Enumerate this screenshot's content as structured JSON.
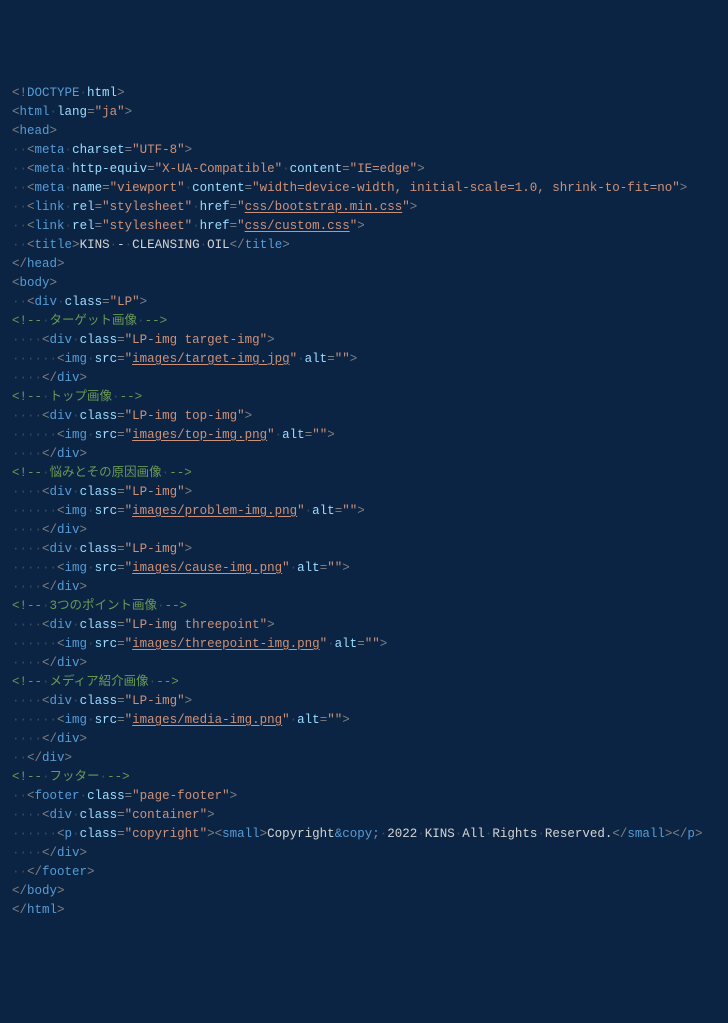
{
  "dot": "·",
  "lines": [
    [
      [
        "punc",
        "<!"
      ],
      [
        "tag",
        "DOCTYPE"
      ],
      [
        "ws",
        " "
      ],
      [
        "attr",
        "html"
      ],
      [
        "punc",
        ">"
      ]
    ],
    [
      [
        "punc",
        "<"
      ],
      [
        "tag",
        "html"
      ],
      [
        "ws",
        " "
      ],
      [
        "attr",
        "lang"
      ],
      [
        "punc",
        "="
      ],
      [
        "str",
        "\"ja\""
      ],
      [
        "punc",
        ">"
      ]
    ],
    [
      [
        "punc",
        "<"
      ],
      [
        "tag",
        "head"
      ],
      [
        "punc",
        ">"
      ]
    ],
    [
      [
        "ws",
        "  "
      ],
      [
        "punc",
        "<"
      ],
      [
        "tag",
        "meta"
      ],
      [
        "ws",
        " "
      ],
      [
        "attr",
        "charset"
      ],
      [
        "punc",
        "="
      ],
      [
        "str",
        "\"UTF-8\""
      ],
      [
        "punc",
        ">"
      ]
    ],
    [
      [
        "ws",
        "  "
      ],
      [
        "punc",
        "<"
      ],
      [
        "tag",
        "meta"
      ],
      [
        "ws",
        " "
      ],
      [
        "attr",
        "http-equiv"
      ],
      [
        "punc",
        "="
      ],
      [
        "str",
        "\"X-UA-Compatible\""
      ],
      [
        "ws",
        " "
      ],
      [
        "attr",
        "content"
      ],
      [
        "punc",
        "="
      ],
      [
        "str",
        "\"IE=edge\""
      ],
      [
        "punc",
        ">"
      ]
    ],
    [
      [
        "ws",
        "  "
      ],
      [
        "punc",
        "<"
      ],
      [
        "tag",
        "meta"
      ],
      [
        "ws",
        " "
      ],
      [
        "attr",
        "name"
      ],
      [
        "punc",
        "="
      ],
      [
        "str",
        "\"viewport\""
      ],
      [
        "ws",
        " "
      ],
      [
        "attr",
        "content"
      ],
      [
        "punc",
        "="
      ],
      [
        "str",
        "\"width=device-width, initial-scale=1.0, shrink-to-fit=no\""
      ],
      [
        "punc",
        ">"
      ]
    ],
    [
      [
        "ws",
        "  "
      ],
      [
        "punc",
        "<"
      ],
      [
        "tag",
        "link"
      ],
      [
        "ws",
        " "
      ],
      [
        "attr",
        "rel"
      ],
      [
        "punc",
        "="
      ],
      [
        "str",
        "\"stylesheet\""
      ],
      [
        "ws",
        " "
      ],
      [
        "attr",
        "href"
      ],
      [
        "punc",
        "="
      ],
      [
        "str",
        "\""
      ],
      [
        "strlink",
        "css/bootstrap.min.css"
      ],
      [
        "str",
        "\""
      ],
      [
        "punc",
        ">"
      ]
    ],
    [
      [
        "ws",
        "  "
      ],
      [
        "punc",
        "<"
      ],
      [
        "tag",
        "link"
      ],
      [
        "ws",
        " "
      ],
      [
        "attr",
        "rel"
      ],
      [
        "punc",
        "="
      ],
      [
        "str",
        "\"stylesheet\""
      ],
      [
        "ws",
        " "
      ],
      [
        "attr",
        "href"
      ],
      [
        "punc",
        "="
      ],
      [
        "str",
        "\""
      ],
      [
        "strlink",
        "css/custom.css"
      ],
      [
        "str",
        "\""
      ],
      [
        "punc",
        ">"
      ]
    ],
    [
      [
        "ws",
        "  "
      ],
      [
        "punc",
        "<"
      ],
      [
        "tag",
        "title"
      ],
      [
        "punc",
        ">"
      ],
      [
        "txt",
        "KINS"
      ],
      [
        "ws",
        " "
      ],
      [
        "txt",
        "-"
      ],
      [
        "ws",
        " "
      ],
      [
        "txt",
        "CLEANSING"
      ],
      [
        "ws",
        " "
      ],
      [
        "txt",
        "OIL"
      ],
      [
        "punc",
        "</"
      ],
      [
        "tag",
        "title"
      ],
      [
        "punc",
        ">"
      ]
    ],
    [
      [
        "punc",
        "</"
      ],
      [
        "tag",
        "head"
      ],
      [
        "punc",
        ">"
      ]
    ],
    [
      [
        "punc",
        "<"
      ],
      [
        "tag",
        "body"
      ],
      [
        "punc",
        ">"
      ]
    ],
    [
      [
        "ws",
        "  "
      ],
      [
        "punc",
        "<"
      ],
      [
        "tag",
        "div"
      ],
      [
        "ws",
        " "
      ],
      [
        "attr",
        "class"
      ],
      [
        "punc",
        "="
      ],
      [
        "str",
        "\"LP\""
      ],
      [
        "punc",
        ">"
      ]
    ],
    [
      [
        "comment",
        "<!--"
      ],
      [
        "ws",
        " "
      ],
      [
        "comment",
        "ターゲット画像"
      ],
      [
        "ws",
        " "
      ],
      [
        "comment",
        "-->"
      ]
    ],
    [
      [
        "ws",
        "    "
      ],
      [
        "punc",
        "<"
      ],
      [
        "tag",
        "div"
      ],
      [
        "ws",
        " "
      ],
      [
        "attr",
        "class"
      ],
      [
        "punc",
        "="
      ],
      [
        "str",
        "\"LP-img target-img\""
      ],
      [
        "punc",
        ">"
      ]
    ],
    [
      [
        "ws",
        "      "
      ],
      [
        "punc",
        "<"
      ],
      [
        "tag",
        "img"
      ],
      [
        "ws",
        " "
      ],
      [
        "attr",
        "src"
      ],
      [
        "punc",
        "="
      ],
      [
        "str",
        "\""
      ],
      [
        "strlink",
        "images/target-img.jpg"
      ],
      [
        "str",
        "\""
      ],
      [
        "ws",
        " "
      ],
      [
        "attr",
        "alt"
      ],
      [
        "punc",
        "="
      ],
      [
        "str",
        "\"\""
      ],
      [
        "punc",
        ">"
      ]
    ],
    [
      [
        "ws",
        "    "
      ],
      [
        "punc",
        "</"
      ],
      [
        "tag",
        "div"
      ],
      [
        "punc",
        ">"
      ]
    ],
    [
      [
        "comment",
        "<!--"
      ],
      [
        "ws",
        " "
      ],
      [
        "comment",
        "トップ画像"
      ],
      [
        "ws",
        " "
      ],
      [
        "comment",
        "-->"
      ]
    ],
    [
      [
        "ws",
        "    "
      ],
      [
        "punc",
        "<"
      ],
      [
        "tag",
        "div"
      ],
      [
        "ws",
        " "
      ],
      [
        "attr",
        "class"
      ],
      [
        "punc",
        "="
      ],
      [
        "str",
        "\"LP-img top-img\""
      ],
      [
        "punc",
        ">"
      ]
    ],
    [
      [
        "ws",
        "      "
      ],
      [
        "punc",
        "<"
      ],
      [
        "tag",
        "img"
      ],
      [
        "ws",
        " "
      ],
      [
        "attr",
        "src"
      ],
      [
        "punc",
        "="
      ],
      [
        "str",
        "\""
      ],
      [
        "strlink",
        "images/top-img.png"
      ],
      [
        "str",
        "\""
      ],
      [
        "ws",
        " "
      ],
      [
        "attr",
        "alt"
      ],
      [
        "punc",
        "="
      ],
      [
        "str",
        "\"\""
      ],
      [
        "punc",
        ">"
      ]
    ],
    [
      [
        "ws",
        "    "
      ],
      [
        "punc",
        "</"
      ],
      [
        "tag",
        "div"
      ],
      [
        "punc",
        ">"
      ]
    ],
    [
      [
        "comment",
        "<!--"
      ],
      [
        "ws",
        " "
      ],
      [
        "comment",
        "悩みとその原因画像"
      ],
      [
        "ws",
        " "
      ],
      [
        "comment",
        "-->"
      ]
    ],
    [
      [
        "ws",
        "    "
      ],
      [
        "punc",
        "<"
      ],
      [
        "tag",
        "div"
      ],
      [
        "ws",
        " "
      ],
      [
        "attr",
        "class"
      ],
      [
        "punc",
        "="
      ],
      [
        "str",
        "\"LP-img\""
      ],
      [
        "punc",
        ">"
      ]
    ],
    [
      [
        "ws",
        "      "
      ],
      [
        "punc",
        "<"
      ],
      [
        "tag",
        "img"
      ],
      [
        "ws",
        " "
      ],
      [
        "attr",
        "src"
      ],
      [
        "punc",
        "="
      ],
      [
        "str",
        "\""
      ],
      [
        "strlink",
        "images/problem-img.png"
      ],
      [
        "str",
        "\""
      ],
      [
        "ws",
        " "
      ],
      [
        "attr",
        "alt"
      ],
      [
        "punc",
        "="
      ],
      [
        "str",
        "\"\""
      ],
      [
        "punc",
        ">"
      ]
    ],
    [
      [
        "ws",
        "    "
      ],
      [
        "punc",
        "</"
      ],
      [
        "tag",
        "div"
      ],
      [
        "punc",
        ">"
      ]
    ],
    [
      [
        "ws",
        "    "
      ],
      [
        "punc",
        "<"
      ],
      [
        "tag",
        "div"
      ],
      [
        "ws",
        " "
      ],
      [
        "attr",
        "class"
      ],
      [
        "punc",
        "="
      ],
      [
        "str",
        "\"LP-img\""
      ],
      [
        "punc",
        ">"
      ]
    ],
    [
      [
        "ws",
        "      "
      ],
      [
        "punc",
        "<"
      ],
      [
        "tag",
        "img"
      ],
      [
        "ws",
        " "
      ],
      [
        "attr",
        "src"
      ],
      [
        "punc",
        "="
      ],
      [
        "str",
        "\""
      ],
      [
        "strlink",
        "images/cause-img.png"
      ],
      [
        "str",
        "\""
      ],
      [
        "ws",
        " "
      ],
      [
        "attr",
        "alt"
      ],
      [
        "punc",
        "="
      ],
      [
        "str",
        "\"\""
      ],
      [
        "punc",
        ">"
      ]
    ],
    [
      [
        "ws",
        "    "
      ],
      [
        "punc",
        "</"
      ],
      [
        "tag",
        "div"
      ],
      [
        "punc",
        ">"
      ]
    ],
    [
      [
        "comment",
        "<!--"
      ],
      [
        "ws",
        " "
      ],
      [
        "comment",
        "3つのポイント画像"
      ],
      [
        "ws",
        " "
      ],
      [
        "comment",
        "-->"
      ]
    ],
    [
      [
        "ws",
        "    "
      ],
      [
        "punc",
        "<"
      ],
      [
        "tag",
        "div"
      ],
      [
        "ws",
        " "
      ],
      [
        "attr",
        "class"
      ],
      [
        "punc",
        "="
      ],
      [
        "str",
        "\"LP-img threepoint\""
      ],
      [
        "punc",
        ">"
      ]
    ],
    [
      [
        "ws",
        "      "
      ],
      [
        "punc",
        "<"
      ],
      [
        "tag",
        "img"
      ],
      [
        "ws",
        " "
      ],
      [
        "attr",
        "src"
      ],
      [
        "punc",
        "="
      ],
      [
        "str",
        "\""
      ],
      [
        "strlink",
        "images/threepoint-img.png"
      ],
      [
        "str",
        "\""
      ],
      [
        "ws",
        " "
      ],
      [
        "attr",
        "alt"
      ],
      [
        "punc",
        "="
      ],
      [
        "str",
        "\"\""
      ],
      [
        "punc",
        ">"
      ]
    ],
    [
      [
        "ws",
        "    "
      ],
      [
        "punc",
        "</"
      ],
      [
        "tag",
        "div"
      ],
      [
        "punc",
        ">"
      ]
    ],
    [
      [
        "comment",
        "<!--"
      ],
      [
        "ws",
        " "
      ],
      [
        "comment",
        "メディア紹介画像"
      ],
      [
        "ws",
        " "
      ],
      [
        "comment",
        "-->"
      ]
    ],
    [
      [
        "ws",
        "    "
      ],
      [
        "punc",
        "<"
      ],
      [
        "tag",
        "div"
      ],
      [
        "ws",
        " "
      ],
      [
        "attr",
        "class"
      ],
      [
        "punc",
        "="
      ],
      [
        "str",
        "\"LP-img\""
      ],
      [
        "punc",
        ">"
      ]
    ],
    [
      [
        "ws",
        "      "
      ],
      [
        "punc",
        "<"
      ],
      [
        "tag",
        "img"
      ],
      [
        "ws",
        " "
      ],
      [
        "attr",
        "src"
      ],
      [
        "punc",
        "="
      ],
      [
        "str",
        "\""
      ],
      [
        "strlink",
        "images/media-img.png"
      ],
      [
        "str",
        "\""
      ],
      [
        "ws",
        " "
      ],
      [
        "attr",
        "alt"
      ],
      [
        "punc",
        "="
      ],
      [
        "str",
        "\"\""
      ],
      [
        "punc",
        ">"
      ]
    ],
    [
      [
        "ws",
        "    "
      ],
      [
        "punc",
        "</"
      ],
      [
        "tag",
        "div"
      ],
      [
        "punc",
        ">"
      ]
    ],
    [
      [
        "ws",
        "  "
      ],
      [
        "punc",
        "</"
      ],
      [
        "tag",
        "div"
      ],
      [
        "punc",
        ">"
      ]
    ],
    [
      [
        "comment",
        "<!--"
      ],
      [
        "ws",
        " "
      ],
      [
        "comment",
        "フッター"
      ],
      [
        "ws",
        " "
      ],
      [
        "comment",
        "-->"
      ]
    ],
    [
      [
        "ws",
        "  "
      ],
      [
        "punc",
        "<"
      ],
      [
        "tag",
        "footer"
      ],
      [
        "ws",
        " "
      ],
      [
        "attr",
        "class"
      ],
      [
        "punc",
        "="
      ],
      [
        "str",
        "\"page-footer\""
      ],
      [
        "punc",
        ">"
      ]
    ],
    [
      [
        "ws",
        "    "
      ],
      [
        "punc",
        "<"
      ],
      [
        "tag",
        "div"
      ],
      [
        "ws",
        " "
      ],
      [
        "attr",
        "class"
      ],
      [
        "punc",
        "="
      ],
      [
        "str",
        "\"container\""
      ],
      [
        "punc",
        ">"
      ]
    ],
    [
      [
        "ws",
        "      "
      ],
      [
        "punc",
        "<"
      ],
      [
        "tag",
        "p"
      ],
      [
        "ws",
        " "
      ],
      [
        "attr",
        "class"
      ],
      [
        "punc",
        "="
      ],
      [
        "str",
        "\"copyright\""
      ],
      [
        "punc",
        ">"
      ],
      [
        "punc",
        "<"
      ],
      [
        "tag",
        "small"
      ],
      [
        "punc",
        ">"
      ],
      [
        "txt",
        "Copyright"
      ],
      [
        "ent",
        "&copy;"
      ],
      [
        "ws",
        " "
      ],
      [
        "txt",
        "2022"
      ],
      [
        "ws",
        " "
      ],
      [
        "txt",
        "KINS"
      ],
      [
        "ws",
        " "
      ],
      [
        "txt",
        "All"
      ],
      [
        "ws",
        " "
      ],
      [
        "txt",
        "Rights"
      ],
      [
        "ws",
        " "
      ],
      [
        "txt",
        "Reserved."
      ],
      [
        "punc",
        "</"
      ],
      [
        "tag",
        "small"
      ],
      [
        "punc",
        ">"
      ],
      [
        "punc",
        "</"
      ],
      [
        "tag",
        "p"
      ],
      [
        "punc",
        ">"
      ]
    ],
    [
      [
        "ws",
        "    "
      ],
      [
        "punc",
        "</"
      ],
      [
        "tag",
        "div"
      ],
      [
        "punc",
        ">"
      ]
    ],
    [
      [
        "ws",
        "  "
      ],
      [
        "punc",
        "</"
      ],
      [
        "tag",
        "footer"
      ],
      [
        "punc",
        ">"
      ]
    ],
    [
      [
        "punc",
        "</"
      ],
      [
        "tag",
        "body"
      ],
      [
        "punc",
        ">"
      ]
    ],
    [
      [
        "punc",
        "</"
      ],
      [
        "tag",
        "html"
      ],
      [
        "punc",
        ">"
      ]
    ]
  ]
}
